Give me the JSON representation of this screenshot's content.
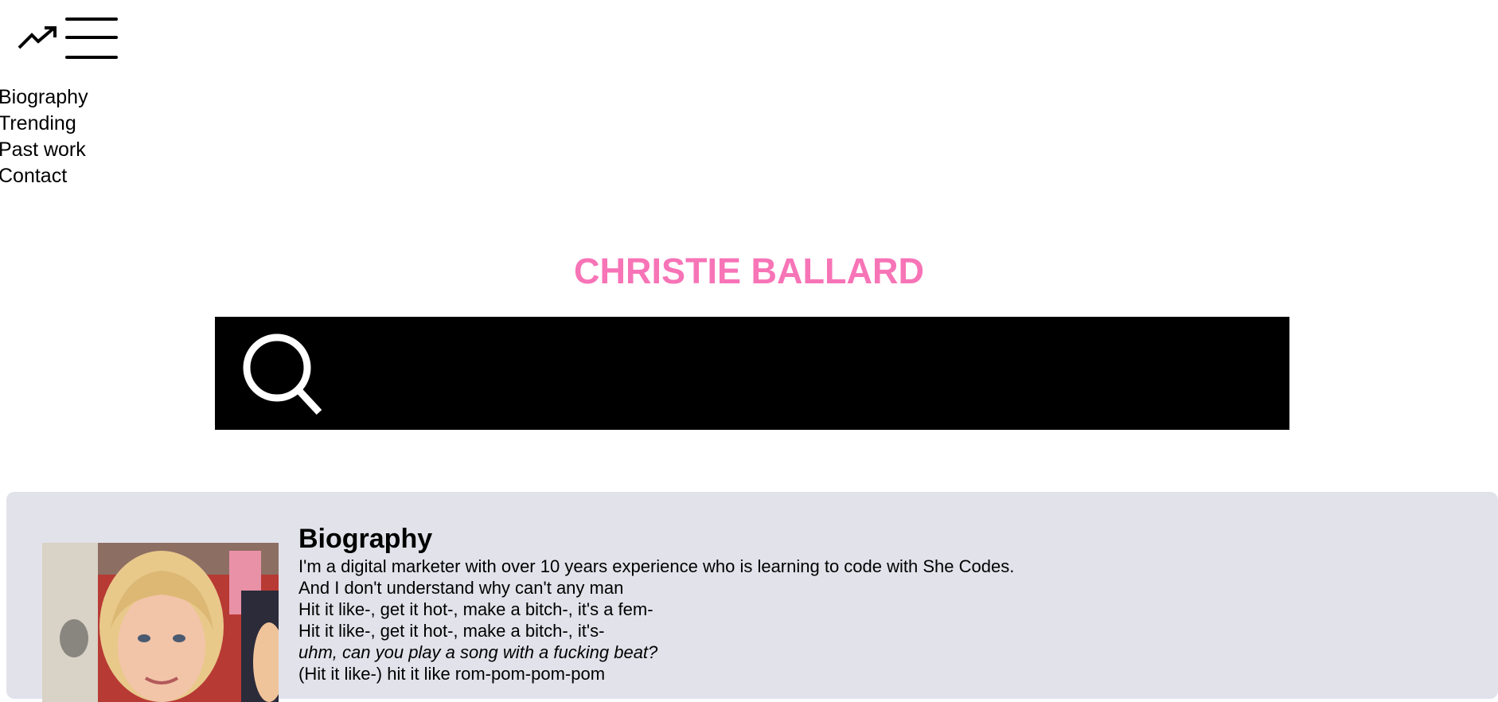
{
  "header": {
    "trending_icon": "trending-up-icon",
    "menu_icon": "hamburger-menu-icon"
  },
  "nav": {
    "items": [
      {
        "label": "Biography"
      },
      {
        "label": "Trending"
      },
      {
        "label": "Past work"
      },
      {
        "label": "Contact"
      }
    ]
  },
  "hero": {
    "title": "CHRISTIE BALLARD",
    "title_color": "#f774b7"
  },
  "search": {
    "icon": "search-icon",
    "value": "",
    "placeholder": ""
  },
  "biography": {
    "heading": "Biography",
    "photo_icon": "profile-photo",
    "lines": [
      "I'm a digital marketer with over 10 years experience who is learning to code with She Codes.",
      "And I don't understand why can't any man",
      "Hit it like-, get it hot-, make a bitch-, it's a fem-",
      "Hit it like-, get it hot-, make a bitch-, it's-",
      "uhm, can you play a song with a fucking beat?",
      "(Hit it like-) hit it like rom-pom-pom-pom"
    ],
    "card_color": "#e1e2ea"
  }
}
